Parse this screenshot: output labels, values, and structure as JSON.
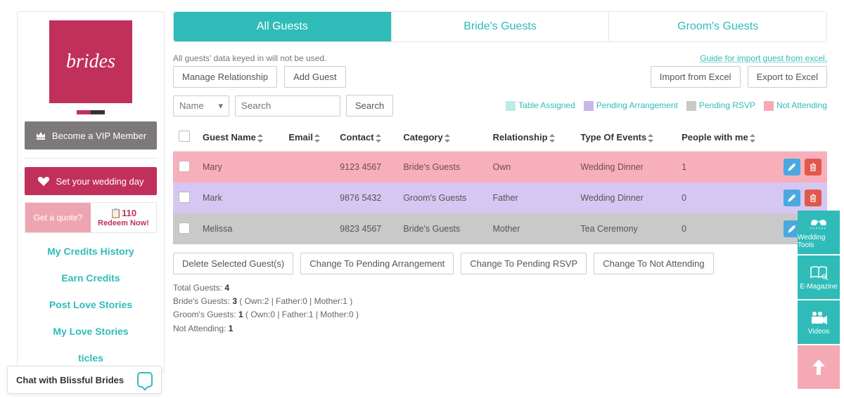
{
  "logo_text": "brides",
  "sidebar": {
    "vip": "Become a VIP Member",
    "set_day": "Set your wedding day",
    "quote_left": "Get a quote?",
    "quote_right_top": "110",
    "quote_right_sub": "Redeem Now!",
    "links": [
      "My Credits History",
      "Earn Credits",
      "Post Love Stories",
      "My Love Stories",
      "ticles"
    ]
  },
  "tabs": [
    "All Guests",
    "Bride's Guests",
    "Groom's Guests"
  ],
  "note": "All guests' data keyed in will not be used.",
  "buttons": {
    "manage_rel": "Manage Relationship",
    "add_guest": "Add Guest",
    "import_excel": "Import from Excel",
    "export_excel": "Export to Excel",
    "search": "Search"
  },
  "import_guide": "Guide for import guest from excel.",
  "filter": {
    "field": "Name",
    "placeholder": "Search"
  },
  "legend": {
    "table_assigned": "Table Assigned",
    "pending_arr": "Pending Arrangement",
    "pending_rsvp": "Pending RSVP",
    "not_attending": "Not Attending"
  },
  "columns": [
    "Guest Name",
    "Email",
    "Contact",
    "Category",
    "Relationship",
    "Type Of Events",
    "People with me"
  ],
  "rows": [
    {
      "status": "pink",
      "name": "Mary",
      "email": "",
      "contact": "9123 4567",
      "category": "Bride's Guests",
      "relation": "Own",
      "event": "Wedding Dinner",
      "people": "1"
    },
    {
      "status": "purple",
      "name": "Mark",
      "email": "",
      "contact": "9876 5432",
      "category": "Groom's Guests",
      "relation": "Father",
      "event": "Wedding Dinner",
      "people": "0"
    },
    {
      "status": "grey",
      "name": "Melissa",
      "email": "",
      "contact": "9823 4567",
      "category": "Bride's Guests",
      "relation": "Mother",
      "event": "Tea Ceremony",
      "people": "0"
    }
  ],
  "actions": {
    "delete": "Delete Selected Guest(s)",
    "to_pending_arr": "Change To Pending Arrangement",
    "to_pending_rsvp": "Change To Pending RSVP",
    "to_not_attending": "Change To Not Attending"
  },
  "summary": {
    "total_label": "Total Guests: ",
    "total": "4",
    "bride_label": "Bride's Guests: ",
    "bride": "3",
    "bride_detail": " ( Own:2 | Father:0 | Mother:1 )",
    "groom_label": "Groom's Guests: ",
    "groom": "1",
    "groom_detail": " ( Own:0 | Father:1 | Mother:0 )",
    "na_label": "Not Attending: ",
    "na": "1"
  },
  "dock": {
    "tools": "Wedding Tools",
    "mag": "E-Magazine",
    "videos": "Videos"
  },
  "chat": "Chat with Blissful Brides"
}
